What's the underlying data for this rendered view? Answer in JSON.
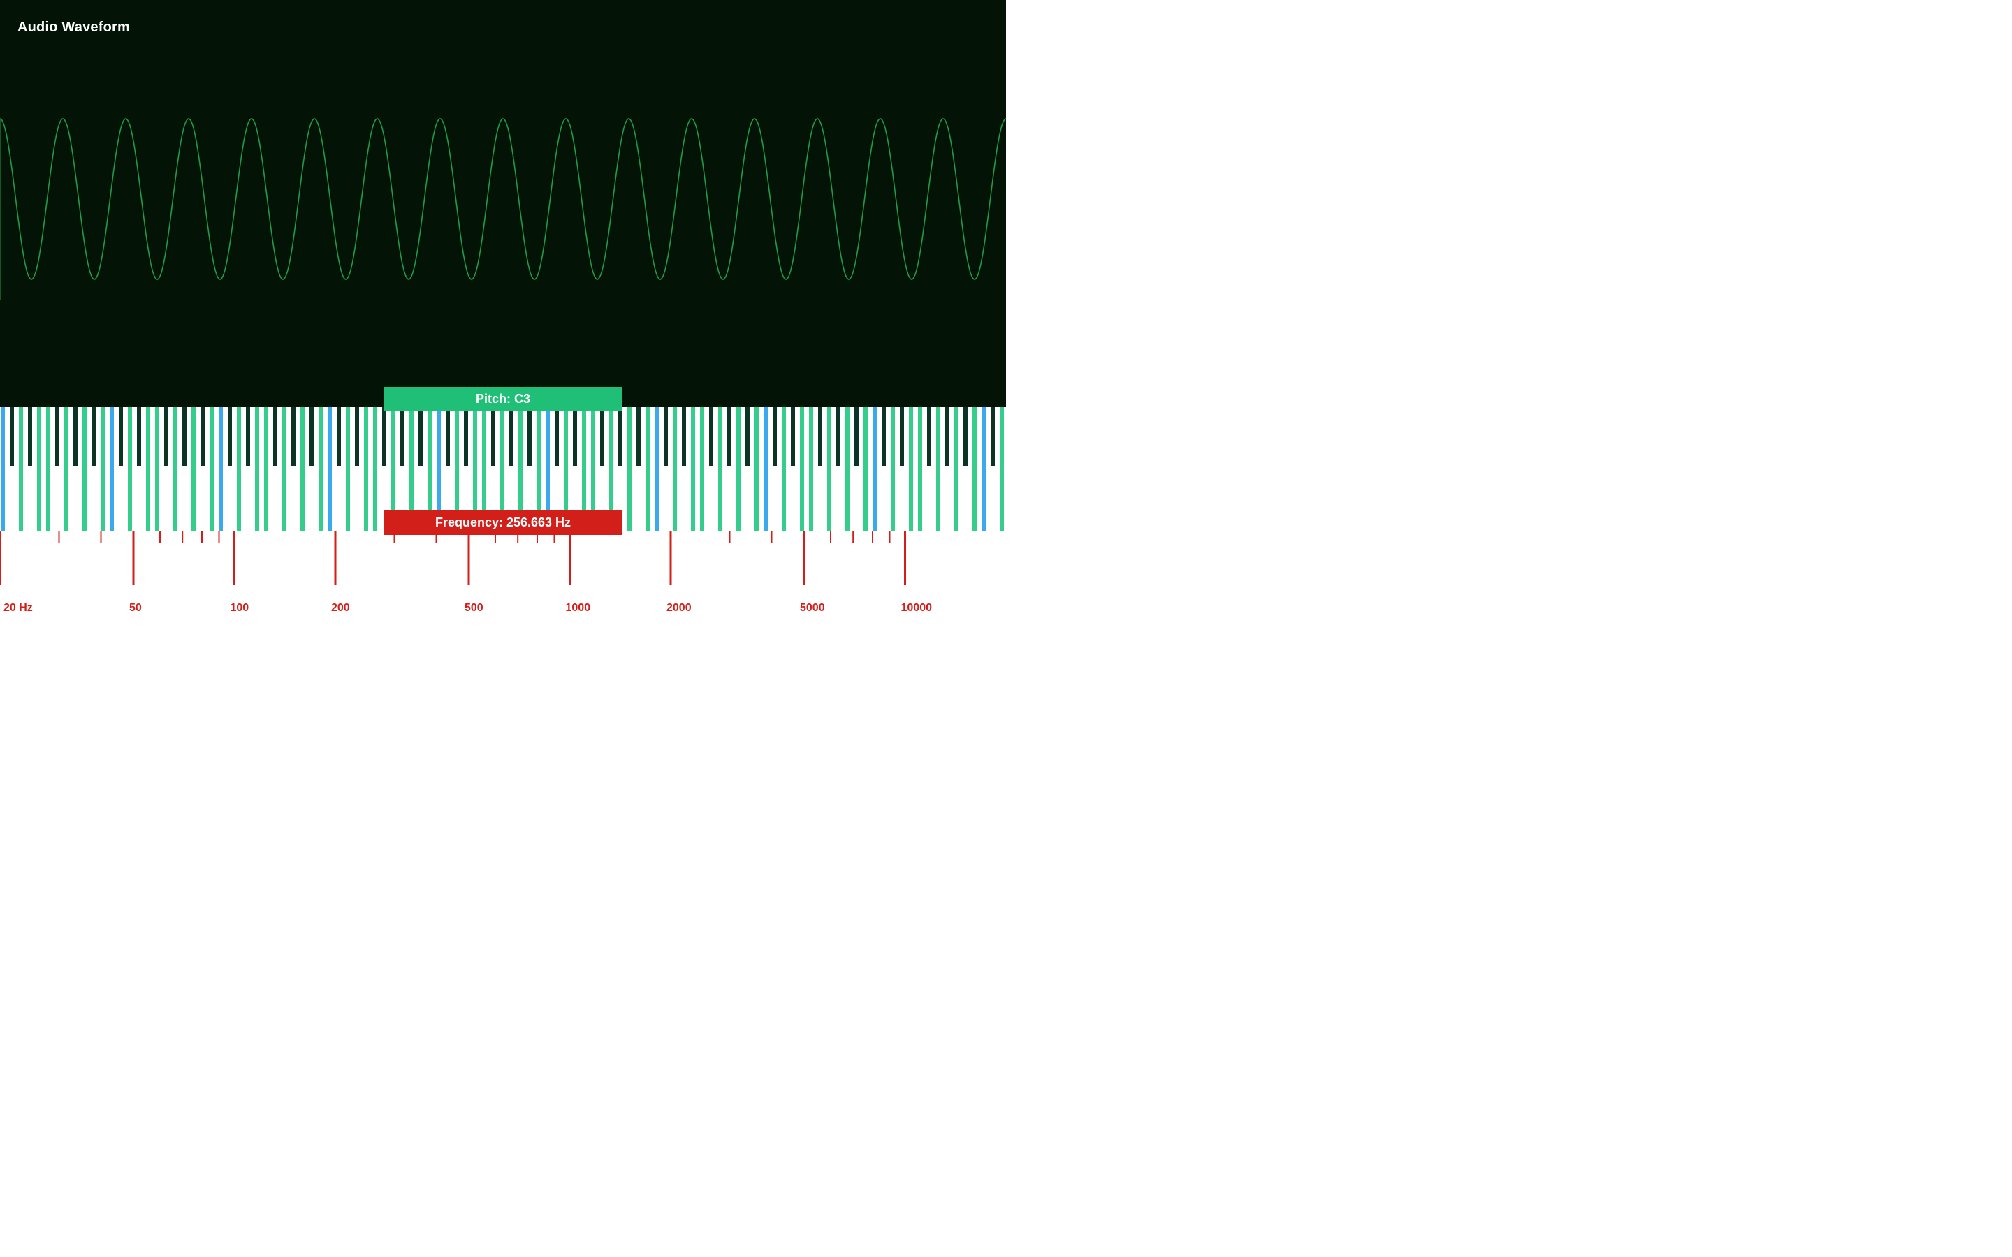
{
  "waveform": {
    "title": "Audio Waveform",
    "cycles": 16,
    "stroke": "#1f9a4a"
  },
  "pitch_badge": {
    "label_prefix": "Pitch: ",
    "value": "C3",
    "bg": "#20bf77"
  },
  "freq_badge": {
    "label_prefix": "Frequency: ",
    "value": "256.663",
    "unit": " Hz",
    "bg": "#d21f1a"
  },
  "piano": {
    "white_key_color": "#34cd8b",
    "black_key_color": "#0b3425",
    "c_key_color": "#3aa9ee",
    "key_width": 6,
    "key_gap": 7,
    "white_len": 177,
    "black_len": 84
  },
  "ruler": {
    "min_hz": 20,
    "max_hz": 20000,
    "ticks_major": [
      {
        "hz": 20,
        "label": "20 Hz"
      },
      {
        "hz": 50,
        "label": "50"
      },
      {
        "hz": 100,
        "label": "100"
      },
      {
        "hz": 200,
        "label": "200"
      },
      {
        "hz": 500,
        "label": "500"
      },
      {
        "hz": 1000,
        "label": "1000"
      },
      {
        "hz": 2000,
        "label": "2000"
      },
      {
        "hz": 5000,
        "label": "5000"
      },
      {
        "hz": 10000,
        "label": "10000"
      }
    ],
    "color": "#d21f1a"
  }
}
